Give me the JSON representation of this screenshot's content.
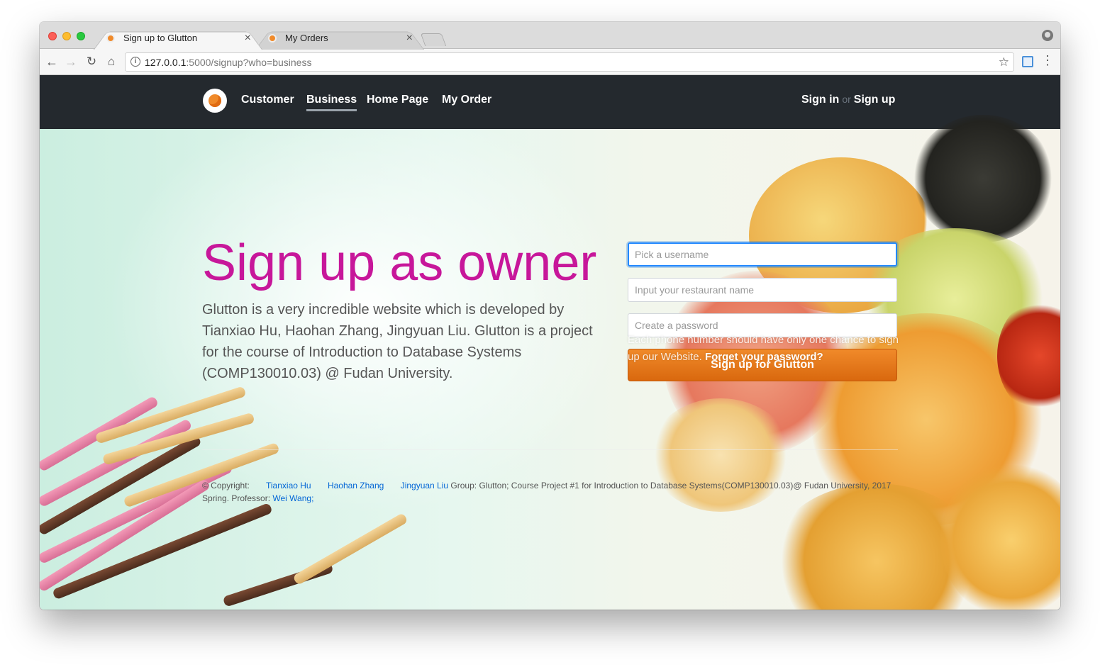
{
  "browser": {
    "tabs": [
      {
        "title": "Sign up to Glutton",
        "close": "×"
      },
      {
        "title": "My Orders",
        "close": "×"
      }
    ],
    "url_host": "127.0.0.1",
    "url_rest": ":5000/signup?who=business",
    "info_glyph": "i",
    "back_glyph": "←",
    "forward_glyph": "→",
    "reload_glyph": "↻",
    "home_glyph": "⌂",
    "star_glyph": "☆",
    "menu_glyph": "⋮"
  },
  "nav": {
    "links": [
      "Customer",
      "Business",
      "Home Page",
      "My Order"
    ],
    "sign_in": "Sign in",
    "or": "or",
    "sign_up": "Sign up"
  },
  "hero": {
    "title": "Sign up as owner",
    "description": "Glutton is a very incredible website which is developed by Tianxiao Hu, Haohan Zhang, Jingyuan Liu. Glutton is a project for the course of Introduction to Database Systems (COMP130010.03) @ Fudan University."
  },
  "form": {
    "username_placeholder": "Pick a username",
    "restaurant_placeholder": "Input your restaurant name",
    "password_placeholder": "Create a password",
    "submit_label": "Sign up for Glutton",
    "note": "Each phone number should have only one chance to sign up our Website.",
    "forgot": "Forget your password?"
  },
  "footer": {
    "copyright": "© Copyright:",
    "authors": [
      "Tianxiao Hu",
      "Haohan Zhang",
      "Jingyuan Liu"
    ],
    "group_text": "Group: Glutton; Course Project #1 for Introduction to Database Systems(COMP130010.03)@ Fudan University, 2017 Spring. Professor:",
    "professor": "Wei Wang;"
  },
  "colors": {
    "accent_title": "#c7179a",
    "button": "#e8771a",
    "navbar": "#24292e",
    "link": "#0366d6"
  },
  "icons": [
    "close-icon",
    "info-icon",
    "star-icon",
    "profile-icon",
    "menu-icon",
    "logo-icon"
  ]
}
